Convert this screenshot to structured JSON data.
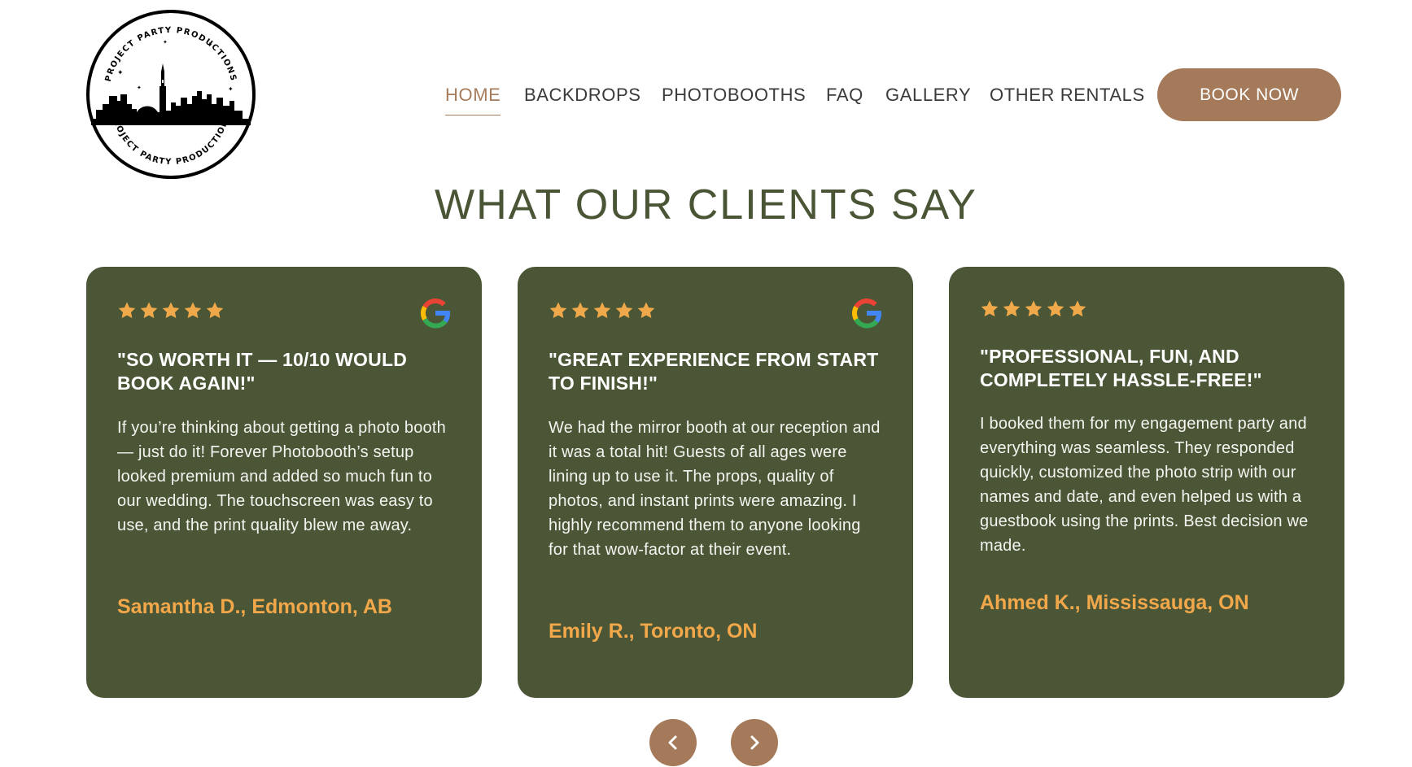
{
  "brand": {
    "logo_text": "PROJECT PARTY PRODUCTIONS"
  },
  "nav": {
    "items": [
      {
        "label": "HOME",
        "active": true
      },
      {
        "label": "BACKDROPS",
        "active": false
      },
      {
        "label": "PHOTOBOOTHS",
        "active": false
      },
      {
        "label": "FAQ",
        "active": false
      },
      {
        "label": "GALLERY",
        "active": false
      },
      {
        "label": "OTHER RENTALS",
        "active": false
      }
    ],
    "cta_label": "BOOK NOW"
  },
  "section": {
    "title": "WHAT OUR CLIENTS SAY"
  },
  "testimonials": [
    {
      "rating": 5,
      "source_icon": "google-icon",
      "title": "\"SO WORTH IT — 10/10 WOULD BOOK AGAIN!\"",
      "body": "If you’re thinking about getting a photo booth — just do it! Forever Photobooth’s setup looked premium and added so much fun to our wedding. The touchscreen was easy to use, and the print quality blew me away.",
      "author": "Samantha D., Edmonton, AB"
    },
    {
      "rating": 5,
      "source_icon": "google-icon",
      "title": "\"GREAT EXPERIENCE FROM START TO FINISH!\"",
      "body": "We had the mirror booth at our reception and it was a total hit! Guests of all ages were lining up to use it. The props, quality of photos, and instant prints were amazing. I highly recommend them to anyone looking for that wow-factor at their event.",
      "author": "Emily R., Toronto, ON"
    },
    {
      "rating": 5,
      "source_icon": null,
      "title": "\"PROFESSIONAL, FUN, AND COMPLETELY HASSLE-FREE!\"",
      "body": "I booked them for my engagement party and everything was seamless. They responded quickly, customized the photo strip with our names and date, and even helped us with a guestbook using the prints. Best decision we made.",
      "author": "Ahmed K., Mississauga, ON"
    }
  ],
  "carousel": {
    "prev_icon": "chevron-left-icon",
    "next_icon": "chevron-right-icon"
  },
  "colors": {
    "card_bg": "#4a5635",
    "accent_brown": "#a57a5a",
    "author_orange": "#f2a84a",
    "star_gold": "#f0a94a",
    "title_green": "#4a5535"
  }
}
